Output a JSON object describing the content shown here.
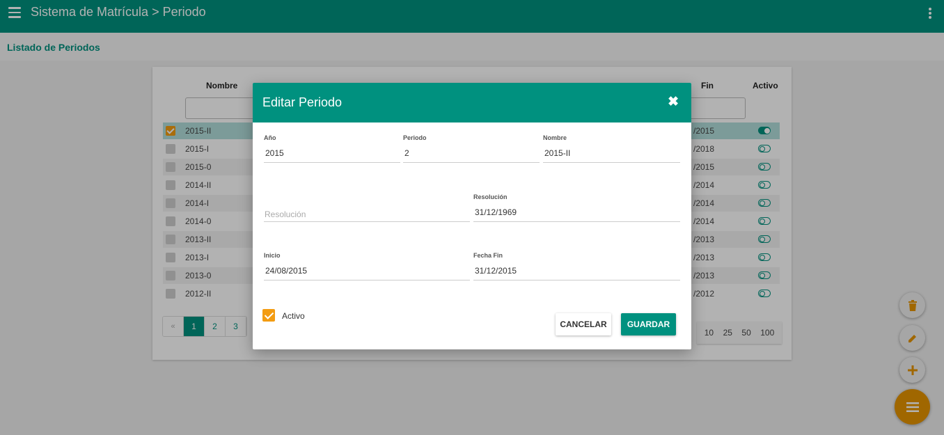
{
  "app": {
    "title": "Sistema de Matrícula > Periodo"
  },
  "section": {
    "title": "Listado de Periodos"
  },
  "table": {
    "headers": {
      "nombre": "Nombre",
      "fin": "Fin",
      "activo": "Activo"
    },
    "rows": [
      {
        "nombre": "2015-II",
        "fin": "/2015",
        "activo": true,
        "selected": true
      },
      {
        "nombre": "2015-I",
        "fin": "/2018",
        "activo": false
      },
      {
        "nombre": "2015-0",
        "fin": "/2015",
        "activo": false
      },
      {
        "nombre": "2014-II",
        "fin": "/2014",
        "activo": false
      },
      {
        "nombre": "2014-I",
        "fin": "/2014",
        "activo": false
      },
      {
        "nombre": "2014-0",
        "fin": "/2014",
        "activo": false
      },
      {
        "nombre": "2013-II",
        "fin": "/2013",
        "activo": false
      },
      {
        "nombre": "2013-I",
        "fin": "/2013",
        "activo": false
      },
      {
        "nombre": "2013-0",
        "fin": "/2013",
        "activo": false
      },
      {
        "nombre": "2012-II",
        "fin": "/2012",
        "activo": false
      }
    ],
    "pager": {
      "prev": "«",
      "pages": [
        "1",
        "2",
        "3"
      ],
      "current": "1"
    },
    "page_sizes": [
      "10",
      "25",
      "50",
      "100"
    ]
  },
  "modal": {
    "title": "Editar Periodo",
    "close_icon": "✖",
    "fields": {
      "anio": {
        "label": "Año",
        "value": "2015"
      },
      "periodo": {
        "label": "Periodo",
        "value": "2"
      },
      "nombre": {
        "label": "Nombre",
        "value": "2015-II"
      },
      "resolucion": {
        "placeholder": "Resolución"
      },
      "fecha_resolucion": {
        "label": "Resolución",
        "value": "31/12/1969"
      },
      "inicio": {
        "label": "Inicio",
        "value": "24/08/2015"
      },
      "fecha_fin": {
        "label": "Fecha Fin",
        "value": "31/12/2015"
      }
    },
    "activo_label": "Activo",
    "activo": true,
    "cancel_label": "CANCELAR",
    "save_label": "GUARDAR"
  },
  "fabs": {
    "delete_icon": "trash-icon",
    "edit_icon": "pencil-icon",
    "add_icon": "plus-icon",
    "menu_icon": "menu-icon"
  },
  "colors": {
    "primary": "#00917f",
    "accent": "#f39c12",
    "fab": "#e59400"
  }
}
